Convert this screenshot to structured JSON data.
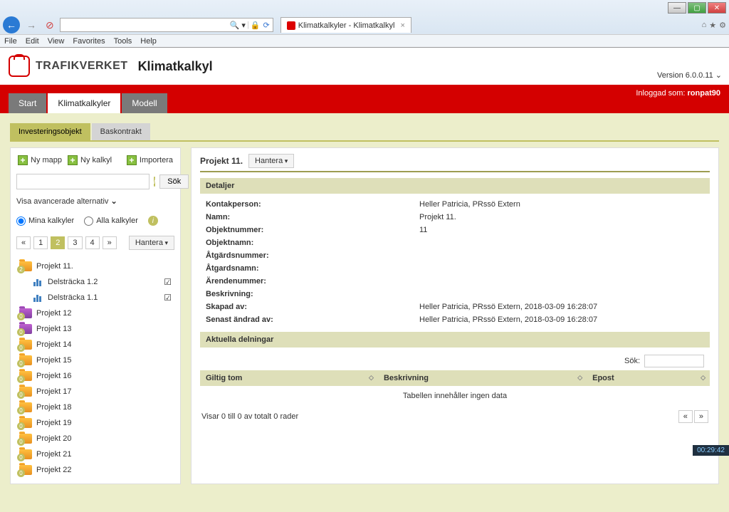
{
  "browser": {
    "menus": [
      "File",
      "Edit",
      "View",
      "Favorites",
      "Tools",
      "Help"
    ],
    "tab_title": "Klimatkalkyler - Klimatkalkyl",
    "search_hint": "🔍 ▾",
    "lock": "🔒",
    "refresh": "⟳"
  },
  "version": "Version 6.0.0.11",
  "brand": "TRAFIKVERKET",
  "app_title": "Klimatkalkyl",
  "login_prefix": "Inloggad som: ",
  "login_user": "ronpat90",
  "main_tabs": {
    "start": "Start",
    "kk": "Klimatkalkyler",
    "modell": "Modell"
  },
  "subtabs": {
    "invest": "Investeringsobjekt",
    "bas": "Baskontrakt"
  },
  "toolbar": {
    "ny_mapp": "Ny mapp",
    "ny_kalkyl": "Ny kalkyl",
    "importera": "Importera"
  },
  "search_btn": "Sök",
  "adv_toggle": "Visa avancerade alternativ",
  "radio": {
    "mina": "Mina kalkyler",
    "alla": "Alla kalkyler"
  },
  "hantera": "Hantera",
  "pages": [
    "«",
    "1",
    "2",
    "3",
    "4",
    "»"
  ],
  "tree": {
    "p11": "Projekt 11.",
    "d12": "Delsträcka 1.2",
    "d11": "Delsträcka 1.1",
    "p12": "Projekt 12",
    "p13": "Projekt 13",
    "p14": "Projekt 14",
    "p15": "Projekt 15",
    "p16": "Projekt 16",
    "p17": "Projekt 17",
    "p18": "Projekt 18",
    "p19": "Projekt 19",
    "p20": "Projekt 20",
    "p21": "Projekt 21",
    "p22": "Projekt 22"
  },
  "main_title": "Projekt 11.",
  "section_detaljer": "Detaljer",
  "section_delningar": "Aktuella delningar",
  "labels": {
    "kontakt": "Kontakperson:",
    "namn": "Namn:",
    "objnr": "Objektnummer:",
    "objnamn": "Objektnamn:",
    "atgnr": "Åtgärdsnummer:",
    "atgnamn": "Åtgardsnamn:",
    "arende": "Ärendenummer:",
    "beskr": "Beskrivning:",
    "skapad": "Skapad av:",
    "senast": "Senast ändrad av:"
  },
  "values": {
    "kontakt": "Heller Patricia, PRssö Extern",
    "namn": "Projekt 11.",
    "objnr": "11",
    "skapad": "Heller Patricia, PRssö Extern, 2018-03-09 16:28:07",
    "senast": "Heller Patricia, PRssö Extern, 2018-03-09 16:28:07"
  },
  "sok_lbl": "Sök:",
  "th": {
    "giltig": "Giltig tom",
    "beskr": "Beskrivning",
    "epost": "Epost"
  },
  "empty": "Tabellen innehåller ingen data",
  "foot": "Visar 0 till 0 av totalt 0 rader",
  "clock": "00:29:42"
}
